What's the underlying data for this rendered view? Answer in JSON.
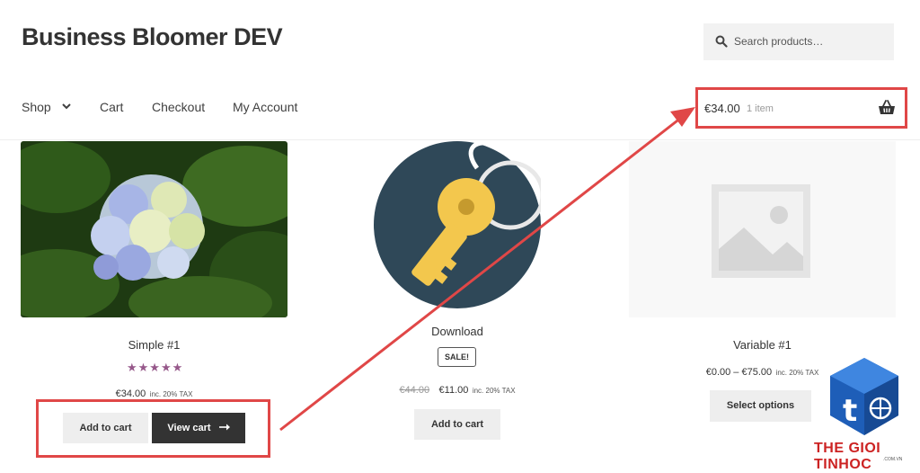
{
  "site": {
    "title": "Business Bloomer DEV"
  },
  "search": {
    "placeholder": "Search products…"
  },
  "nav": {
    "items": [
      {
        "label": "Shop"
      },
      {
        "label": "Cart"
      },
      {
        "label": "Checkout"
      },
      {
        "label": "My Account"
      }
    ]
  },
  "mini_cart": {
    "amount": "€34.00",
    "count": "1 item"
  },
  "products": [
    {
      "title": "Simple #1",
      "rating_stars": "★★★★★",
      "price": "€34.00",
      "tax": "inc. 20% TAX",
      "buttons": {
        "add": "Add to cart",
        "view": "View cart"
      }
    },
    {
      "title": "Download",
      "badge": "SALE!",
      "old_price": "€44.00",
      "price": "€11.00",
      "tax": "inc. 20% TAX",
      "buttons": {
        "add": "Add to cart"
      }
    },
    {
      "title": "Variable #1",
      "price": "€0.00 – €75.00",
      "tax": "inc. 20% TAX",
      "buttons": {
        "select": "Select options"
      }
    }
  ],
  "watermark": {
    "text": "THE GIOI TINHOC",
    "sub": ".COM.VN"
  },
  "colors": {
    "annotation_red": "#e04747",
    "star": "#96588a",
    "dark_button": "#333333",
    "light_button": "#eeeeee",
    "key_bg": "#2f4858",
    "key_gold": "#f3c74d"
  }
}
